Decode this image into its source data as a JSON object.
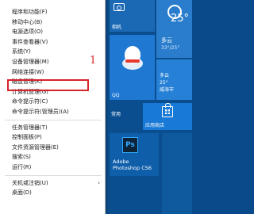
{
  "start_screen": {
    "camera_label": "相机",
    "weather": {
      "temp": "25°",
      "condition": "多云",
      "range": "33°/25°"
    },
    "weather2": {
      "lines": [
        "多云",
        "25°",
        "威海市"
      ]
    },
    "qq_label": "QQ",
    "group_label": "常用",
    "store_label": "应用商店",
    "ps": {
      "icon_text": "Ps",
      "label_line1": "Adobe",
      "label_line2": "Photoshop CS6"
    }
  },
  "context_menu": {
    "items": [
      {
        "label": "程序和功能(F)"
      },
      {
        "label": "移动中心(B)"
      },
      {
        "label": "电源选项(O)"
      },
      {
        "label": "事件查看器(V)"
      },
      {
        "label": "系统(Y)"
      },
      {
        "label": "设备管理器(M)"
      },
      {
        "label": "网络连接(W)"
      },
      {
        "label": "磁盘管理(K)"
      },
      {
        "label": "计算机管理(G)"
      },
      {
        "label": "命令提示符(C)"
      },
      {
        "label": "命令提示符(管理员)(A)"
      },
      {
        "label": "任务管理器(T)"
      },
      {
        "label": "控制面板(P)"
      },
      {
        "label": "文件资源管理器(E)"
      },
      {
        "label": "搜索(S)"
      },
      {
        "label": "运行(R)"
      },
      {
        "label": "关机或注销(U)"
      },
      {
        "label": "桌面(D)"
      }
    ],
    "submenu_arrow": "›"
  },
  "annotation": {
    "number": "1",
    "color": "#d8232a"
  }
}
